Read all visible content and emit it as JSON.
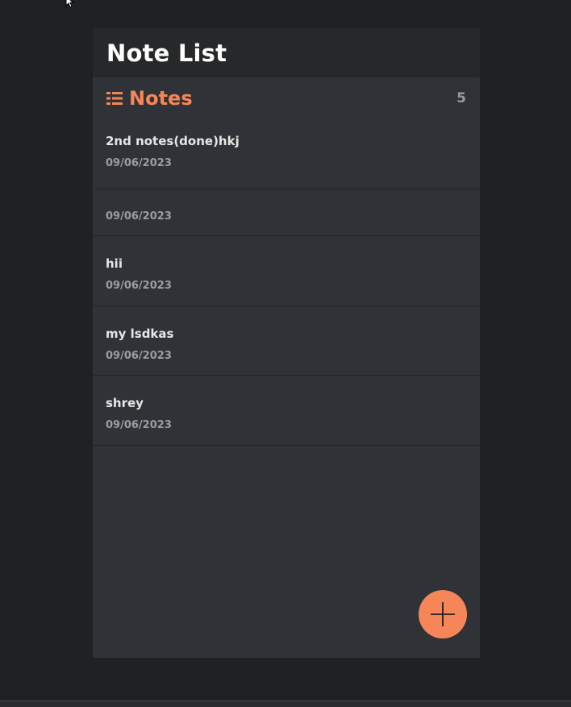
{
  "app": {
    "title": "Note List"
  },
  "notes_section": {
    "heading": "Notes",
    "count": "5",
    "icon": "list-icon",
    "accent_color": "#f68657"
  },
  "notes": [
    {
      "title": "2nd notes(done)hkj",
      "date": "09/06/2023"
    },
    {
      "title": "",
      "date": "09/06/2023"
    },
    {
      "title": "hii",
      "date": "09/06/2023"
    },
    {
      "title": "my lsdkas",
      "date": "09/06/2023"
    },
    {
      "title": "shrey",
      "date": "09/06/2023"
    }
  ],
  "add_button": {
    "icon": "plus-icon"
  },
  "colors": {
    "background": "#202124",
    "panel": "#2f3337",
    "header": "#26282a",
    "accent": "#f68657"
  }
}
